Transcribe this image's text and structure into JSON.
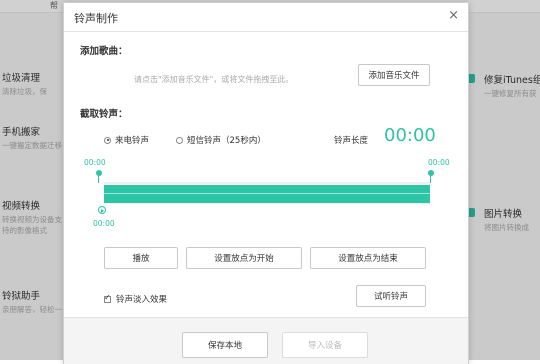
{
  "background": {
    "top_text": "帮",
    "left_items": [
      {
        "title": "垃圾清理",
        "subtitle": "清除垃圾，保"
      },
      {
        "title": "手机搬家",
        "subtitle": "一键搬定数据迁移"
      },
      {
        "title": "视频转换",
        "subtitle": "转换视频为设备支持的影像格式"
      },
      {
        "title": "铃狱助手",
        "subtitle": "亲朋解答，轻松一"
      }
    ],
    "right_items": [
      {
        "title": "修复iTunes组",
        "subtitle": "一键修复所有获"
      },
      {
        "title": "图片转换",
        "subtitle": "将图片转换成"
      }
    ]
  },
  "dialog": {
    "title": "铃声制作",
    "close_glyph": "×",
    "add_section": {
      "label": "添加歌曲：",
      "hint": "请点击\"添加音乐文件\"，或将文件拖拽至此。",
      "add_button": "添加音乐文件"
    },
    "cut_section": {
      "label": "截取铃声：",
      "radio_call": "来电铃声",
      "radio_sms": "短信铃声（25秒内）",
      "length_label": "铃声长度",
      "length_value": "00:00",
      "start_time": "00:00",
      "end_time": "00:00",
      "play_time": "00:00"
    },
    "buttons": {
      "play": "播放",
      "set_start": "设置放点为开始",
      "set_end": "设置放点为结束",
      "preview": "试听铃声"
    },
    "fade_checkbox": "铃声淡入效果",
    "footer": {
      "save": "保存本地",
      "import": "导入设备"
    }
  }
}
